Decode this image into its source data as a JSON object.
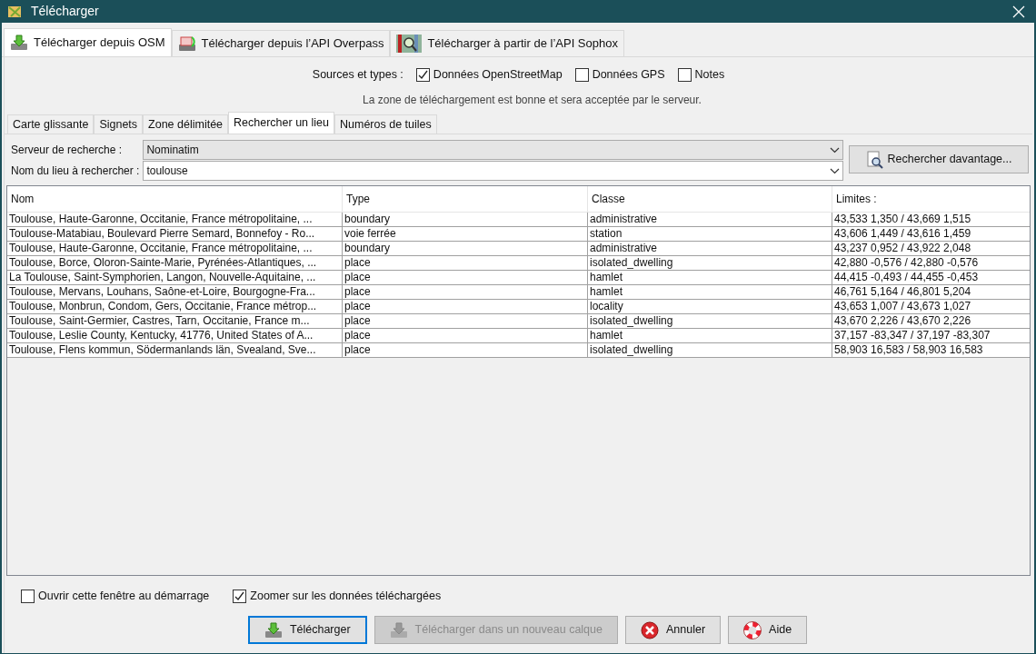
{
  "window": {
    "title": "Télécharger"
  },
  "tabs": [
    {
      "label": "Télécharger depuis OSM",
      "kind": "download",
      "selected": true
    },
    {
      "label": "Télécharger depuis l’API Overpass",
      "kind": "overpass",
      "selected": false
    },
    {
      "label": "Télécharger à partir de l’API Sophox",
      "kind": "map",
      "selected": false
    }
  ],
  "sources": {
    "label": "Sources et types :",
    "options": [
      {
        "label": "Données OpenStreetMap",
        "checked": true
      },
      {
        "label": "Données GPS",
        "checked": false
      },
      {
        "label": "Notes",
        "checked": false
      }
    ]
  },
  "message": "La zone de téléchargement est bonne et sera acceptée par le serveur.",
  "subtabs": [
    {
      "label": "Carte glissante",
      "selected": false
    },
    {
      "label": "Signets",
      "selected": false
    },
    {
      "label": "Zone délimitée",
      "selected": false
    },
    {
      "label": "Rechercher un lieu",
      "selected": true
    },
    {
      "label": "Numéros de tuiles",
      "selected": false
    }
  ],
  "search": {
    "server_label": "Serveur de recherche :",
    "server": "Nominatim",
    "place_label": "Nom du lieu à rechercher :",
    "place": "toulouse",
    "more_button": "Rechercher davantage..."
  },
  "table": {
    "columns": [
      "Nom",
      "Type",
      "Classe",
      "Limites :"
    ],
    "rows": [
      [
        "Toulouse, Haute-Garonne, Occitanie, France métropolitaine, ...",
        "boundary",
        "administrative",
        "43,533 1,350 / 43,669 1,515"
      ],
      [
        "Toulouse-Matabiau, Boulevard Pierre Semard, Bonnefoy - Ro...",
        "voie ferrée",
        "station",
        "43,606 1,449 / 43,616 1,459"
      ],
      [
        "Toulouse, Haute-Garonne, Occitanie, France métropolitaine, ...",
        "boundary",
        "administrative",
        "43,237 0,952 / 43,922 2,048"
      ],
      [
        "Toulouse, Borce, Oloron-Sainte-Marie, Pyrénées-Atlantiques, ...",
        "place",
        "isolated_dwelling",
        "42,880 -0,576 / 42,880 -0,576"
      ],
      [
        "La Toulouse, Saint-Symphorien, Langon, Nouvelle-Aquitaine, ...",
        "place",
        "hamlet",
        "44,415 -0,493 / 44,455 -0,453"
      ],
      [
        "Toulouse, Mervans, Louhans, Saône-et-Loire, Bourgogne-Fra...",
        "place",
        "hamlet",
        "46,761 5,164 / 46,801 5,204"
      ],
      [
        "Toulouse, Monbrun, Condom, Gers, Occitanie, France métrop...",
        "place",
        "locality",
        "43,653 1,007 / 43,673 1,027"
      ],
      [
        "Toulouse, Saint-Germier, Castres, Tarn, Occitanie, France m...",
        "place",
        "isolated_dwelling",
        "43,670 2,226 / 43,670 2,226"
      ],
      [
        "Toulouse, Leslie County, Kentucky, 41776, United States of A...",
        "place",
        "hamlet",
        "37,157 -83,347 / 37,197 -83,307"
      ],
      [
        "Toulouse, Flens kommun, Södermanlands län, Svealand, Sve...",
        "place",
        "isolated_dwelling",
        "58,903 16,583 / 58,903 16,583"
      ]
    ]
  },
  "options": [
    {
      "label": "Ouvrir cette fenêtre au démarrage",
      "checked": false
    },
    {
      "label": "Zoomer sur les données téléchargées",
      "checked": true
    }
  ],
  "buttons": [
    {
      "label": "Télécharger",
      "kind": "download",
      "disabled": false,
      "focused": true
    },
    {
      "label": "Télécharger dans un nouveau calque",
      "kind": "download",
      "disabled": true,
      "focused": false
    },
    {
      "label": "Annuler",
      "kind": "cancel",
      "disabled": false,
      "focused": false
    },
    {
      "label": "Aide",
      "kind": "help",
      "disabled": false,
      "focused": false
    }
  ]
}
